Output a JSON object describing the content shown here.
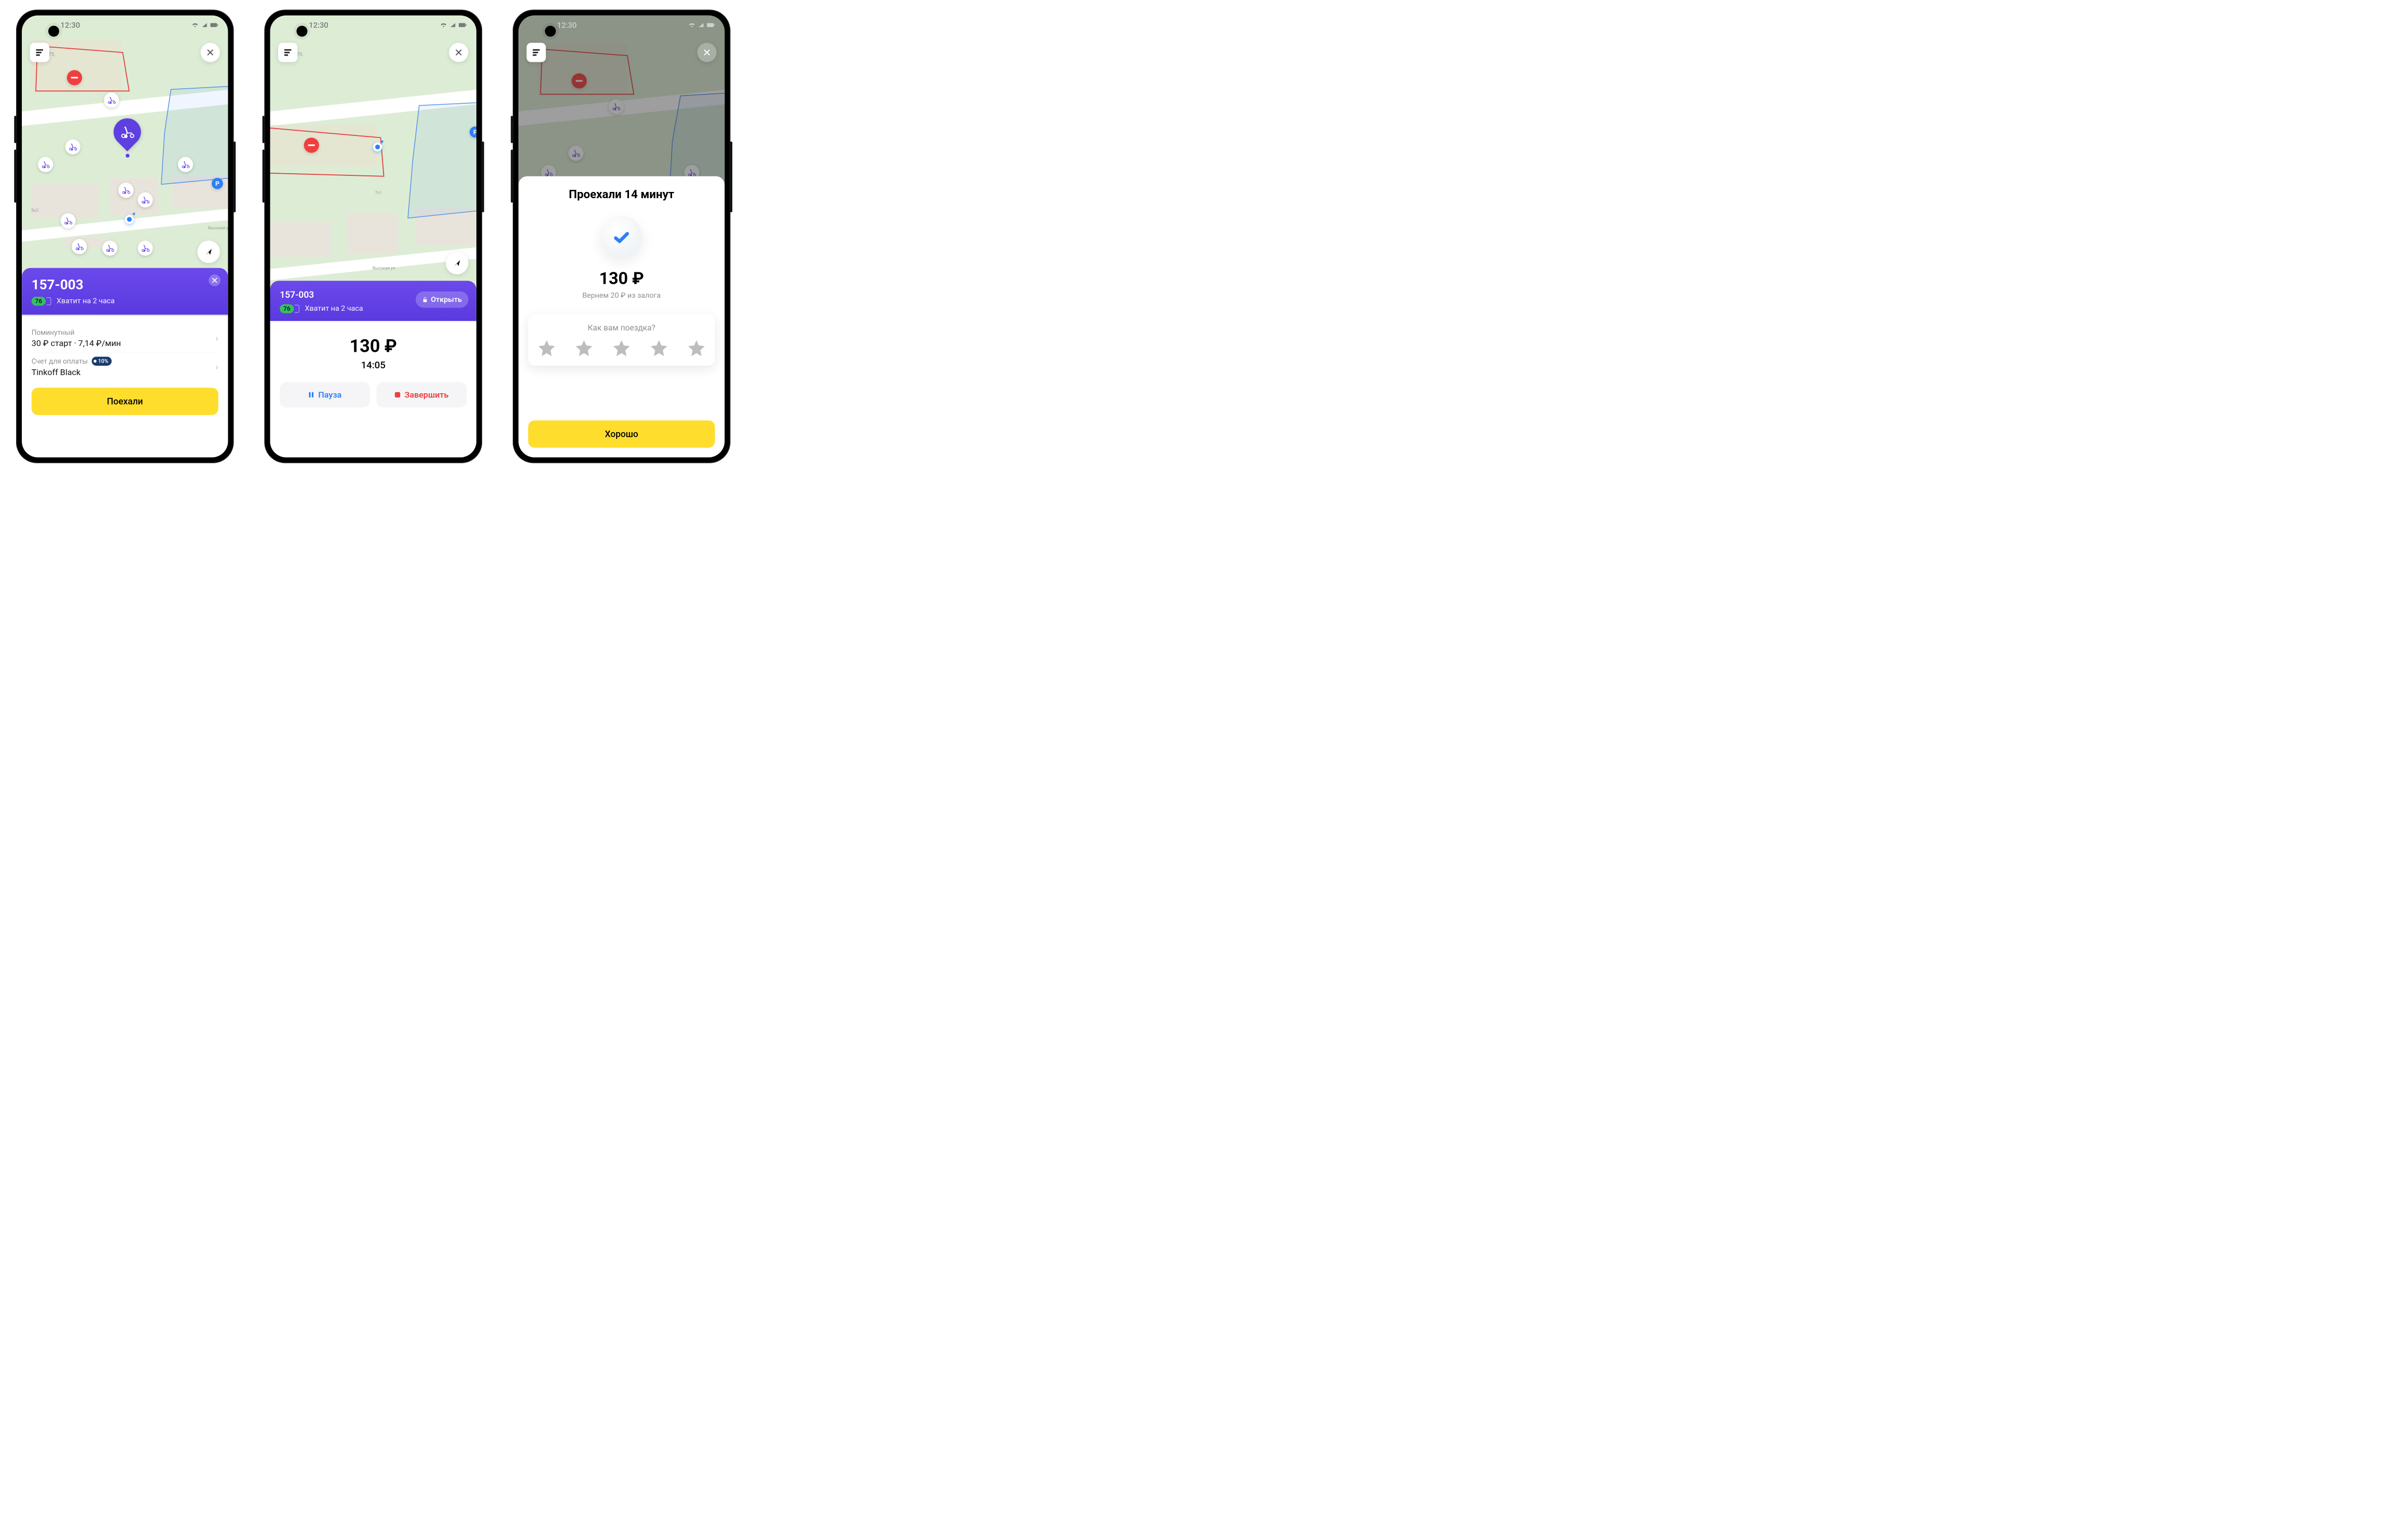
{
  "status": {
    "time": "12:30"
  },
  "markers": {
    "parking_label": "P"
  },
  "screen1": {
    "scooter_id": "157-003",
    "battery": "76",
    "range": "Хватит на 2 часа",
    "tariff_label": "Поминутный",
    "tariff_value": "30 ₽ старт · 7,14 ₽/мин",
    "payment_label": "Счет для оплаты",
    "cashback": "10%",
    "payment_value": "Tinkoff Black",
    "cta": "Поехали"
  },
  "screen2": {
    "scooter_id": "157-003",
    "battery": "76",
    "range": "Хватит на 2 часа",
    "open_label": "Открыть",
    "amount": "130 ₽",
    "time": "14:05",
    "pause": "Пауза",
    "finish": "Завершить"
  },
  "screen3": {
    "title": "Проехали 14 минут",
    "amount": "130 ₽",
    "refund": "Вернем 20 ₽ из залога",
    "rating_q": "Как вам поездка?",
    "cta": "Хорошо"
  }
}
